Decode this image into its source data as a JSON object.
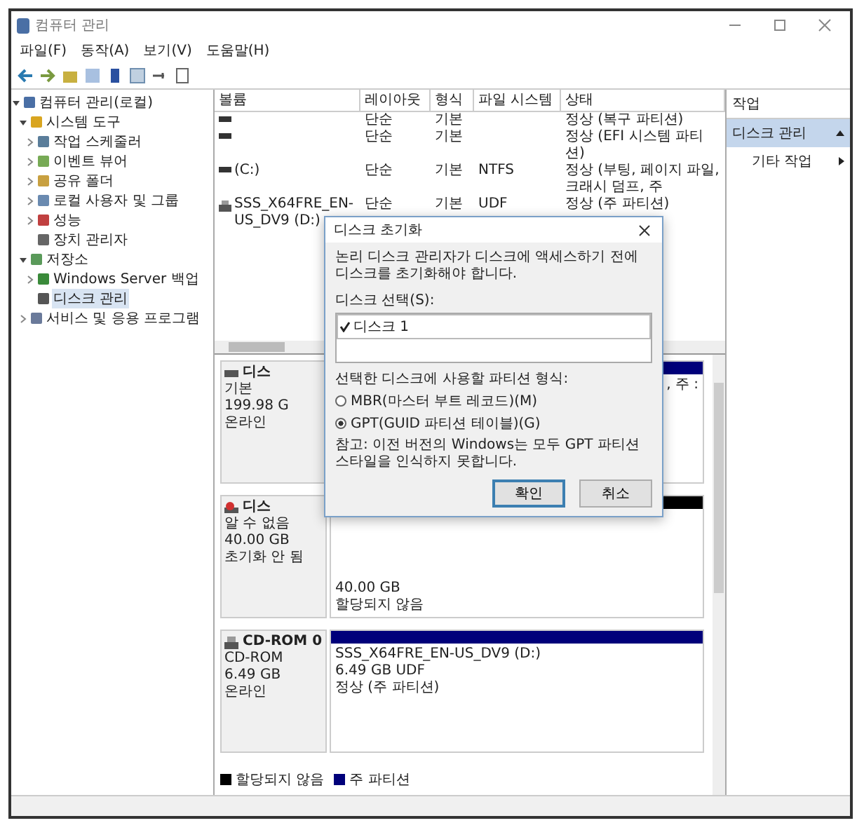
{
  "window": {
    "title": "컴퓨터 관리"
  },
  "menu": [
    "파일(F)",
    "동작(A)",
    "보기(V)",
    "도움말(H)"
  ],
  "tree": [
    {
      "label": "컴퓨터 관리(로컬)",
      "kind": "root",
      "selected": false,
      "expanded": true,
      "children": [
        {
          "label": "시스템 도구",
          "kind": "folder",
          "selected": false,
          "expanded": true,
          "children": [
            {
              "label": "작업 스케줄러",
              "kind": "clock",
              "selected": false,
              "expanded": false
            },
            {
              "label": "이벤트 뷰어",
              "kind": "viewer",
              "selected": false,
              "expanded": false
            },
            {
              "label": "공유 폴더",
              "kind": "share",
              "selected": false,
              "expanded": false
            },
            {
              "label": "로컬 사용자 및 그룹",
              "kind": "users",
              "selected": false,
              "expanded": false
            },
            {
              "label": "성능",
              "kind": "perf",
              "selected": false,
              "expanded": false
            },
            {
              "label": "장치 관리자",
              "kind": "device",
              "selected": false
            }
          ]
        },
        {
          "label": "저장소",
          "kind": "storage",
          "selected": false,
          "expanded": true,
          "children": [
            {
              "label": "Windows Server 백업",
              "kind": "backup",
              "selected": false,
              "expanded": false
            },
            {
              "label": "디스크 관리",
              "kind": "disk",
              "selected": true
            }
          ]
        },
        {
          "label": "서비스 및 응용 프로그램",
          "kind": "services",
          "selected": false,
          "expanded": false
        }
      ]
    }
  ],
  "volume_table": {
    "columns": [
      "볼륨",
      "레이아웃",
      "형식",
      "파일 시스템",
      "상태"
    ],
    "rows": [
      {
        "kind": "volume",
        "cells": [
          "",
          "단순",
          "기본",
          "",
          "정상 (복구 파티션)"
        ]
      },
      {
        "kind": "volume",
        "cells": [
          "",
          "단순",
          "기본",
          "",
          "정상 (EFI 시스템 파티션)"
        ]
      },
      {
        "kind": "volume",
        "cells": [
          "(C:)",
          "단순",
          "기본",
          "NTFS",
          "정상 (부팅, 페이지 파일, 크래시 덤프, 주"
        ]
      },
      {
        "kind": "cd",
        "cells": [
          "SSS_X64FRE_EN-US_DV9 (D:)",
          "단순",
          "기본",
          "UDF",
          "정상 (주 파티션)"
        ]
      }
    ]
  },
  "disks": [
    {
      "kind": "disk",
      "name": "디스",
      "lines": [
        "기본",
        "199.98 G",
        "온라인"
      ],
      "partitions": [
        {
          "kind": "primary",
          "lines": [
            ", 주 :"
          ]
        }
      ]
    },
    {
      "kind": "unknown",
      "name": "디스",
      "lines": [
        "알 수 없음",
        "40.00 GB",
        "초기화 안 됨"
      ],
      "partitions": [
        {
          "kind": "unallocated",
          "lines": [
            "40.00 GB",
            "할당되지 않음"
          ]
        }
      ]
    },
    {
      "kind": "cd",
      "name": "CD-ROM 0",
      "lines": [
        "CD-ROM",
        "6.49 GB",
        "온라인"
      ],
      "partitions": [
        {
          "kind": "primary",
          "lines": [
            "SSS_X64FRE_EN-US_DV9 (D:)",
            "6.49 GB UDF",
            "정상 (주 파티션)"
          ]
        }
      ]
    }
  ],
  "legend": [
    {
      "kind": "unallocated",
      "label": "할당되지 않음"
    },
    {
      "kind": "primary",
      "label": "주 파티션"
    }
  ],
  "actions": {
    "title": "작업",
    "items": [
      {
        "kind": "section",
        "label": "디스크 관리"
      },
      {
        "kind": "more",
        "label": "기타 작업"
      }
    ]
  },
  "dialog": {
    "title": "디스크 초기화",
    "message": "논리 디스크 관리자가 디스크에 액세스하기 전에 디스크를 초기화해야 합니다.",
    "disk_label": "디스크 선택(S):",
    "disk_list": [
      {
        "label": "디스크 1",
        "checked": true
      }
    ],
    "style_label": "선택한 디스크에 사용할 파티션 형식:",
    "options": [
      {
        "label": "MBR(마스터 부트 레코드)(M)",
        "selected": false
      },
      {
        "label": "GPT(GUID 파티션 테이블)(G)",
        "selected": true
      }
    ],
    "note": "참고: 이전 버전의 Windows는 모두 GPT 파티션 스타일을 인식하지 못합니다.",
    "buttons": [
      {
        "label": "확인",
        "default": true
      },
      {
        "label": "취소",
        "default": false
      }
    ]
  }
}
